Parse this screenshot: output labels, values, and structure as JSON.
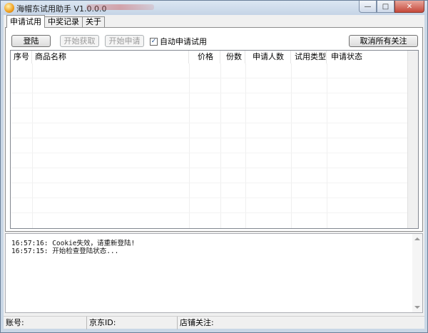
{
  "window": {
    "title": "海帽东试用助手 V1.0.0.0",
    "controls": [
      "minimize-icon",
      "maximize-icon",
      "close-icon"
    ]
  },
  "tabs": [
    {
      "label": "申请试用",
      "active": true
    },
    {
      "label": "中奖记录",
      "active": false
    },
    {
      "label": "关于",
      "active": false
    }
  ],
  "toolbar": {
    "login_label": "登陆",
    "start_fetch_label": "开始获取",
    "start_apply_label": "开始申请",
    "auto_apply_label": "自动申请试用",
    "auto_apply_checked": true,
    "unfollow_all_label": "取消所有关注"
  },
  "table": {
    "columns": [
      "序号",
      "商品名称",
      "价格",
      "份数",
      "申请人数",
      "试用类型",
      "申请状态"
    ],
    "rows": []
  },
  "log": [
    "16:57:16: Cookie失效，请重新登陆!",
    "16:57:15: 开始检查登陆状态..."
  ],
  "status": {
    "account_label": "账号:",
    "jd_id_label": "京东ID:",
    "shop_follow_label": "店铺关注:"
  }
}
